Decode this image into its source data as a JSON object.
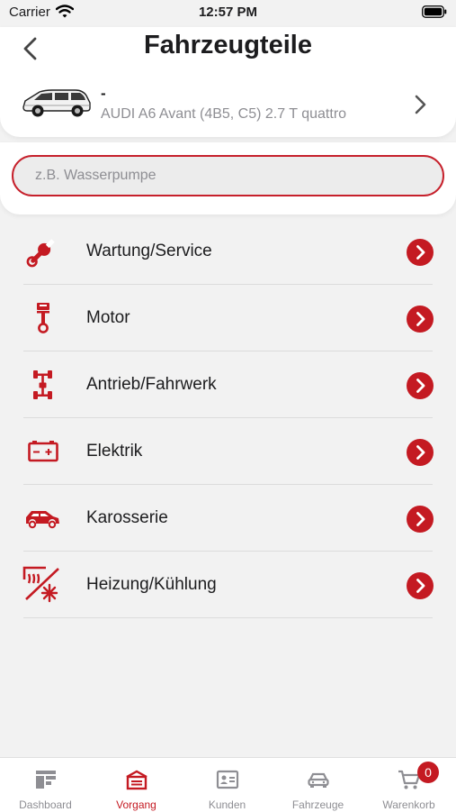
{
  "status_bar": {
    "carrier": "Carrier",
    "time": "12:57 PM"
  },
  "header": {
    "title": "Fahrzeugteile"
  },
  "vehicle": {
    "name": "-",
    "model": "AUDI A6 Avant (4B5, C5) 2.7 T quattro"
  },
  "search": {
    "placeholder": "z.B. Wasserpumpe"
  },
  "categories": [
    {
      "label": "Wartung/Service",
      "icon": "wrench-icon"
    },
    {
      "label": "Motor",
      "icon": "piston-icon"
    },
    {
      "label": "Antrieb/Fahrwerk",
      "icon": "drivetrain-icon"
    },
    {
      "label": "Elektrik",
      "icon": "battery-icon"
    },
    {
      "label": "Karosserie",
      "icon": "car-body-icon"
    },
    {
      "label": "Heizung/Kühlung",
      "icon": "heating-cooling-icon"
    }
  ],
  "tabs": [
    {
      "label": "Dashboard",
      "icon": "dashboard-icon",
      "active": false
    },
    {
      "label": "Vorgang",
      "icon": "garage-icon",
      "active": true
    },
    {
      "label": "Kunden",
      "icon": "contact-card-icon",
      "active": false
    },
    {
      "label": "Fahrzeuge",
      "icon": "car-icon",
      "active": false
    },
    {
      "label": "Warenkorb",
      "icon": "cart-icon",
      "active": false,
      "badge": "0"
    }
  ],
  "colors": {
    "accent": "#c41a22",
    "background": "#f2f2f2",
    "muted": "#8e8e93"
  }
}
